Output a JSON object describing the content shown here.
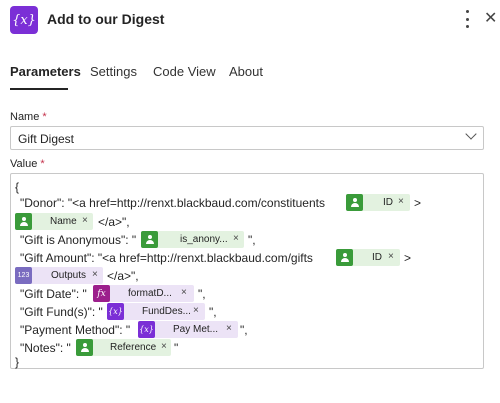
{
  "header": {
    "icon_text": "{x}",
    "title": "Add to our Digest",
    "more_label": "⋮",
    "close_label": "✕"
  },
  "tabs": [
    {
      "label": "Parameters",
      "active": true
    },
    {
      "label": "Settings",
      "active": false
    },
    {
      "label": "Code View",
      "active": false
    },
    {
      "label": "About",
      "active": false
    }
  ],
  "fields": {
    "name": {
      "label": "Name",
      "required_mark": "*",
      "value": "Gift Digest"
    },
    "value": {
      "label": "Value",
      "required_mark": "*"
    }
  },
  "json_text": {
    "open_brace": "{",
    "donor_prefix": "\"Donor\": \"<a href=http://renxt.blackbaud.com/constituents",
    "donor_suffix": ">",
    "donor_close": "</a>\",",
    "anon_prefix": "\"Gift is Anonymous\": \"",
    "anon_suffix": "\",",
    "amount_prefix": "\"Gift Amount\": \"<a href=http://renxt.blackbaud.com/gifts",
    "amount_suffix": ">",
    "amount_close": "</a>\",",
    "date_prefix": "\"Gift Date\": \"",
    "date_suffix": "\",",
    "fund_prefix": "\"Gift Fund(s)\": \"",
    "fund_suffix": "\",",
    "pay_prefix": "\"Payment Method\": \"",
    "pay_suffix": "\",",
    "notes_prefix": "\"Notes\": \"",
    "notes_suffix": "\"",
    "close_brace": "}"
  },
  "tokens": {
    "donor_id": "ID",
    "donor_name": "Name",
    "is_anonymous": "is_anony...",
    "gift_id": "ID",
    "outputs": "Outputs",
    "format_date": "formatD...",
    "fund_desc": "FundDes...",
    "pay_method": "Pay Met...",
    "reference": "Reference",
    "remove_label": "×",
    "fx_label": "fx",
    "var_label": "{x}",
    "num_label": "123"
  },
  "colors": {
    "accent": "#7b2fd6",
    "token_green": "#e3f2e0",
    "token_purple": "#ece3f6",
    "required": "#c4314b"
  }
}
